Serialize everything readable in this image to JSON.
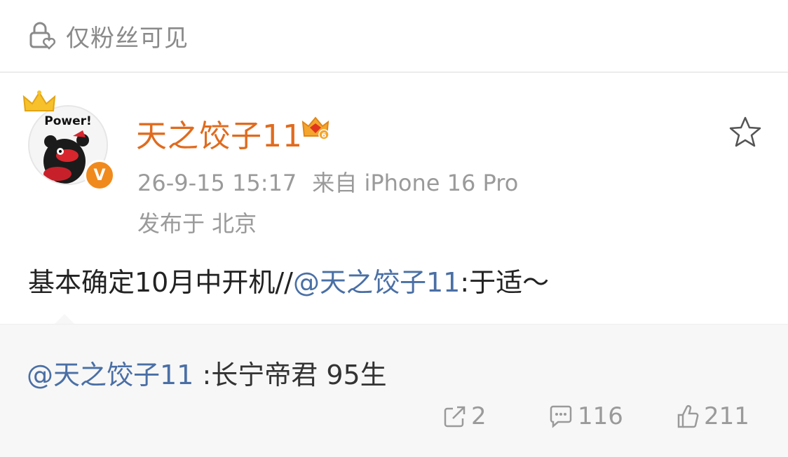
{
  "visibility": {
    "icon": "lock-heart-icon",
    "label": "仅粉丝可见"
  },
  "post": {
    "avatar": {
      "badge_text": "Power!",
      "verified_mark": "V"
    },
    "username": "天之饺子11",
    "vip_badge": {
      "icon": "vip-crown-badge-icon",
      "level": "6"
    },
    "timestamp": "26-9-15 15:17",
    "source": "来自 iPhone 16 Pro",
    "location": "发布于 北京",
    "content": {
      "text_before": "基本确定10月中开机//",
      "mention": "@天之饺子11",
      "text_after": ":于适～"
    },
    "favorite_icon": "star-outline-icon"
  },
  "repost": {
    "mention": "@天之饺子11",
    "text": " :长宁帝君  95生"
  },
  "actions": {
    "share": {
      "icon": "share-icon",
      "count": "2"
    },
    "comment": {
      "icon": "comment-icon",
      "count": "116"
    },
    "like": {
      "icon": "thumbs-up-icon",
      "count": "211"
    }
  }
}
